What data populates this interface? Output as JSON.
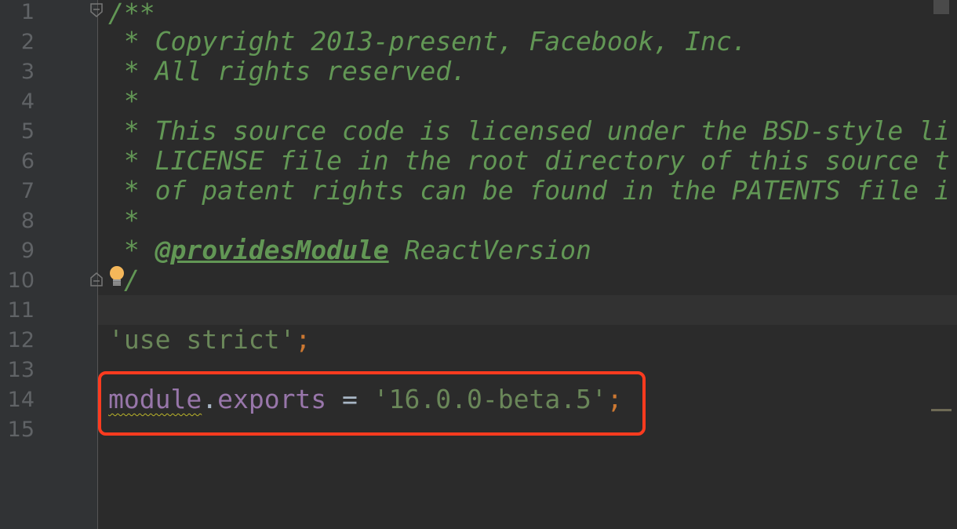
{
  "editor": {
    "line_numbers": [
      "1",
      "2",
      "3",
      "4",
      "5",
      "6",
      "7",
      "8",
      "9",
      "10",
      "11",
      "12",
      "13",
      "14",
      "15"
    ],
    "lines": {
      "l1": "/**",
      "l2": " * Copyright 2013-present, Facebook, Inc.",
      "l3": " * All rights reserved.",
      "l4": " *",
      "l5": " * This source code is licensed under the BSD-style li",
      "l6": " * LICENSE file in the root directory of this source t",
      "l7": " * of patent rights can be found in the PATENTS file i",
      "l8": " *",
      "l9_prefix": " * ",
      "l9_tag": "@providesModule",
      "l9_rest": " ReactVersion",
      "l10": "/",
      "l12_str": "'use strict'",
      "l12_semi": ";",
      "l14_module": "module",
      "l14_dot": ".",
      "l14_exports": "exports",
      "l14_eq": " = ",
      "l14_str": "'16.0.0-beta.5'",
      "l14_semi": ";"
    }
  },
  "colors": {
    "highlight_box": "#ff3b1f",
    "comment": "#629755",
    "string": "#6a8759",
    "keyword": "#cc7832",
    "field": "#9876aa"
  }
}
